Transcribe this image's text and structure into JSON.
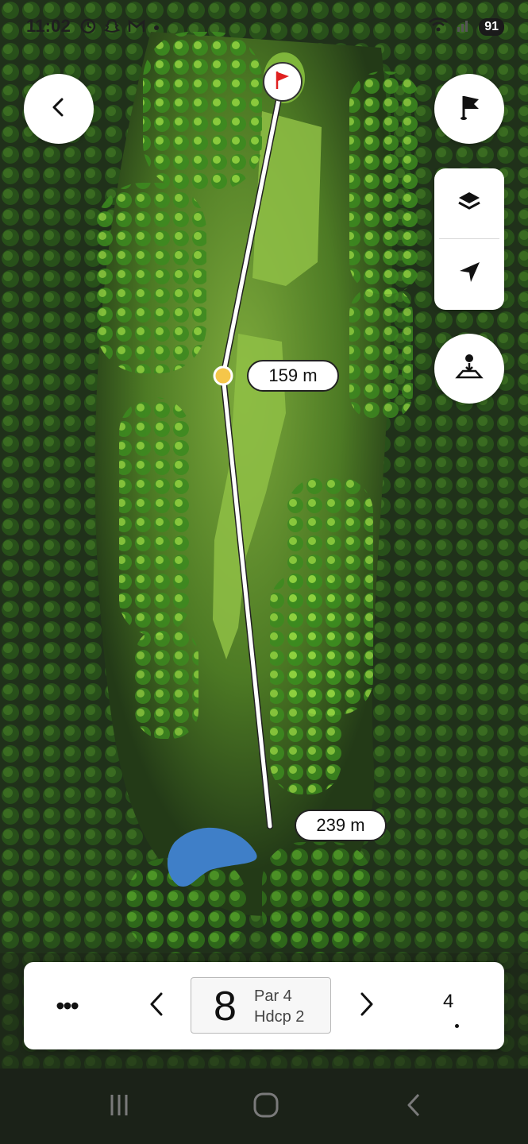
{
  "status_bar": {
    "time": "11:02",
    "battery": "91",
    "icons": [
      "clock-icon",
      "snapchat-icon",
      "gmail-icon",
      "dot-icon",
      "wifi-icon",
      "signal-icon"
    ]
  },
  "map": {
    "type": "golf-hole-satellite-map",
    "flag_icon": "red-flag-icon",
    "distances": {
      "mid_label": "159 m",
      "tee_label": "239 m"
    },
    "colors": {
      "fairway": "#7fae3a",
      "rough": "#5f8f2c",
      "trees": "#3e7f1f",
      "water": "#3f7fc8",
      "line": "#ffffff",
      "waypoint": "#f5c64a",
      "flag": "#e02020"
    }
  },
  "buttons": {
    "back": "chevron-left-icon",
    "flag": "flag-icon",
    "layers": "layers-icon",
    "locate": "navigation-arrow-icon",
    "ball_position": "ball-location-icon"
  },
  "bottom_bar": {
    "more": "•••",
    "hole_number": "8",
    "par": "Par 4",
    "hdcp": "Hdcp 2",
    "strokes": "4"
  },
  "nav_bar": {
    "items": [
      "recent-apps-icon",
      "home-icon",
      "back-icon"
    ]
  }
}
